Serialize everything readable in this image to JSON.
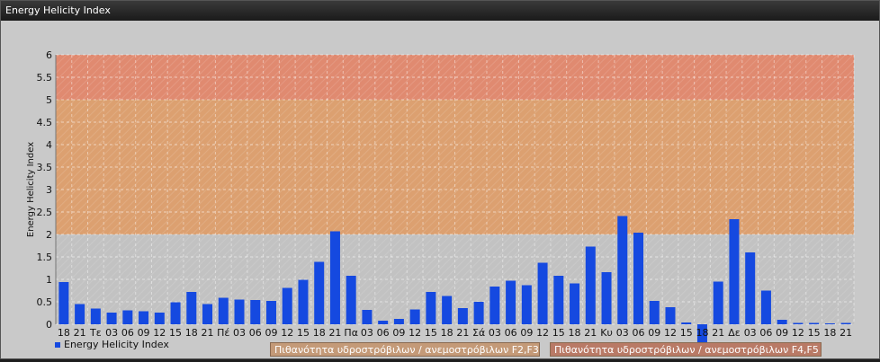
{
  "window": {
    "title": "Energy Helicity Index"
  },
  "legend": {
    "series_label": "Energy Helicity Index"
  },
  "bands": {
    "f2f3_label": "Πιθανότητα υδροστρόβιλων / ανεμοστρόβιλων F2,F3",
    "f4f5_label": "Πιθανότητα υδροστρόβιλων / ανεμοστρόβιλων F4,F5"
  },
  "colors": {
    "bar": "#1549e0",
    "band_low": "#c2c2c2",
    "band_f2f3": "#dca070",
    "band_f4f5_mid": "#e0a070",
    "band_f4f5_high": "#e08a70"
  },
  "chart_data": {
    "type": "bar",
    "ylabel": "Energy Helicity Index",
    "ylim": [
      0,
      6
    ],
    "yticks": [
      "0",
      "0.5",
      "1",
      "1.5",
      "2",
      "2.5",
      "3",
      "3.5",
      "4",
      "4.5",
      "5",
      "5.5",
      "6"
    ],
    "grid": true,
    "legend_position": "bottom-left",
    "categories": [
      "18",
      "21",
      "Τε",
      "03",
      "06",
      "09",
      "12",
      "15",
      "18",
      "21",
      "Πέ",
      "03",
      "06",
      "09",
      "12",
      "15",
      "18",
      "21",
      "Πα",
      "03",
      "06",
      "09",
      "12",
      "15",
      "18",
      "21",
      "Σά",
      "03",
      "06",
      "09",
      "12",
      "15",
      "18",
      "21",
      "Κυ",
      "03",
      "06",
      "09",
      "12",
      "15",
      "18",
      "21",
      "Δε",
      "03",
      "06",
      "09",
      "12",
      "15",
      "18",
      "21"
    ],
    "series": [
      {
        "name": "Energy Helicity Index",
        "values": [
          0.94,
          0.45,
          0.35,
          0.26,
          0.31,
          0.29,
          0.26,
          0.49,
          0.72,
          0.45,
          0.59,
          0.55,
          0.54,
          0.52,
          0.81,
          0.99,
          1.39,
          2.07,
          1.08,
          0.32,
          0.08,
          0.12,
          0.33,
          0.72,
          0.63,
          0.36,
          0.5,
          0.84,
          0.97,
          0.87,
          1.37,
          1.08,
          0.91,
          1.73,
          1.16,
          2.41,
          2.04,
          0.52,
          0.38,
          0.04,
          -0.52,
          0.95,
          2.34,
          1.6,
          0.75,
          0.1,
          0.03,
          0.03,
          0.02,
          0.03
        ]
      }
    ],
    "bands": [
      {
        "from": 0,
        "to": 2
      },
      {
        "from": 2,
        "to": 5
      },
      {
        "from": 5,
        "to": 6
      }
    ]
  }
}
